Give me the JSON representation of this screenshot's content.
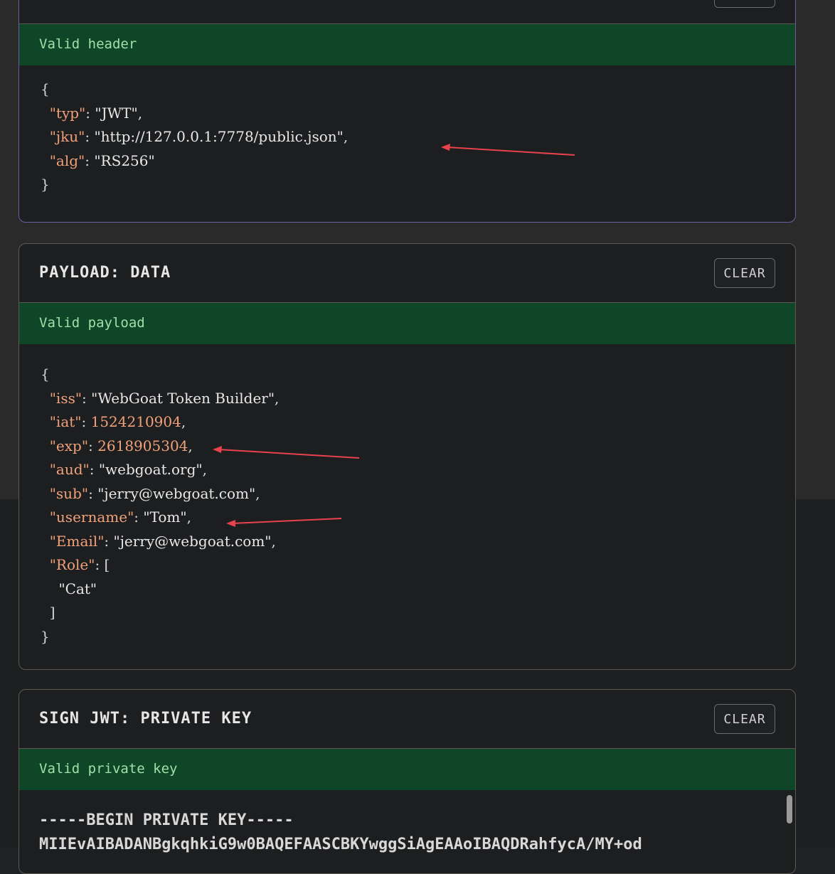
{
  "header_panel": {
    "status": "Valid header",
    "lines": [
      {
        "indent": "",
        "parts": [
          {
            "t": "{",
            "c": "p"
          }
        ]
      },
      {
        "indent": "  ",
        "parts": [
          {
            "t": "\"typ\"",
            "c": "k"
          },
          {
            "t": ": ",
            "c": "p"
          },
          {
            "t": "\"JWT\"",
            "c": "s"
          },
          {
            "t": ",",
            "c": "p"
          }
        ]
      },
      {
        "indent": "  ",
        "parts": [
          {
            "t": "\"jku\"",
            "c": "k"
          },
          {
            "t": ": ",
            "c": "p"
          },
          {
            "t": "\"http://127.0.0.1:7778/public.json\"",
            "c": "s"
          },
          {
            "t": ",",
            "c": "p"
          }
        ]
      },
      {
        "indent": "  ",
        "parts": [
          {
            "t": "\"alg\"",
            "c": "k"
          },
          {
            "t": ": ",
            "c": "p"
          },
          {
            "t": "\"RS256\"",
            "c": "s"
          }
        ]
      },
      {
        "indent": "",
        "parts": [
          {
            "t": "}",
            "c": "p"
          }
        ]
      }
    ]
  },
  "payload_panel": {
    "title": "PAYLOAD: DATA",
    "clear_label": "CLEAR",
    "status": "Valid payload",
    "lines": [
      {
        "indent": "",
        "parts": [
          {
            "t": "{",
            "c": "p"
          }
        ]
      },
      {
        "indent": "  ",
        "parts": [
          {
            "t": "\"iss\"",
            "c": "k"
          },
          {
            "t": ": ",
            "c": "p"
          },
          {
            "t": "\"WebGoat Token Builder\"",
            "c": "s"
          },
          {
            "t": ",",
            "c": "p"
          }
        ]
      },
      {
        "indent": "  ",
        "parts": [
          {
            "t": "\"iat\"",
            "c": "k"
          },
          {
            "t": ": ",
            "c": "p"
          },
          {
            "t": "1524210904",
            "c": "n"
          },
          {
            "t": ",",
            "c": "p"
          }
        ]
      },
      {
        "indent": "  ",
        "parts": [
          {
            "t": "\"exp\"",
            "c": "k"
          },
          {
            "t": ": ",
            "c": "p"
          },
          {
            "t": "2618905304",
            "c": "n"
          },
          {
            "t": ",",
            "c": "p"
          }
        ]
      },
      {
        "indent": "  ",
        "parts": [
          {
            "t": "\"aud\"",
            "c": "k"
          },
          {
            "t": ": ",
            "c": "p"
          },
          {
            "t": "\"webgoat.org\"",
            "c": "s"
          },
          {
            "t": ",",
            "c": "p"
          }
        ]
      },
      {
        "indent": "  ",
        "parts": [
          {
            "t": "\"sub\"",
            "c": "k"
          },
          {
            "t": ": ",
            "c": "p"
          },
          {
            "t": "\"jerry@webgoat.com\"",
            "c": "s"
          },
          {
            "t": ",",
            "c": "p"
          }
        ]
      },
      {
        "indent": "  ",
        "parts": [
          {
            "t": "\"username\"",
            "c": "k"
          },
          {
            "t": ": ",
            "c": "p"
          },
          {
            "t": "\"Tom\"",
            "c": "s"
          },
          {
            "t": ",",
            "c": "p"
          }
        ]
      },
      {
        "indent": "  ",
        "parts": [
          {
            "t": "\"Email\"",
            "c": "k"
          },
          {
            "t": ": ",
            "c": "p"
          },
          {
            "t": "\"jerry@webgoat.com\"",
            "c": "s"
          },
          {
            "t": ",",
            "c": "p"
          }
        ]
      },
      {
        "indent": "  ",
        "parts": [
          {
            "t": "\"Role\"",
            "c": "k"
          },
          {
            "t": ": [",
            "c": "p"
          }
        ]
      },
      {
        "indent": "    ",
        "parts": [
          {
            "t": "\"Cat\"",
            "c": "s"
          }
        ]
      },
      {
        "indent": "  ",
        "parts": [
          {
            "t": "]",
            "c": "p"
          }
        ]
      },
      {
        "indent": "",
        "parts": [
          {
            "t": "}",
            "c": "p"
          }
        ]
      }
    ]
  },
  "sign_panel": {
    "title": "SIGN JWT: PRIVATE KEY",
    "clear_label": "CLEAR",
    "status": "Valid private key",
    "key_line1": "-----BEGIN PRIVATE KEY-----",
    "key_line2": "MIIEvAIBADANBgkqhkiG9w0BAQEFAASCBKYwggSiAgEAAoIBAQDRahfycA/MY+od"
  },
  "colors": {
    "arrow": "#e8434d",
    "status_bg": "#0f4627",
    "status_text": "#9fe0a8"
  }
}
